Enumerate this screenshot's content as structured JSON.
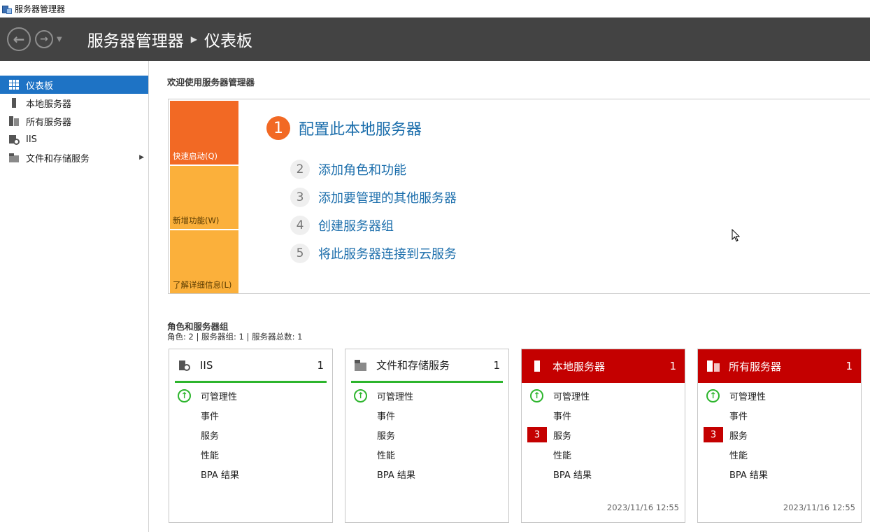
{
  "window": {
    "title": "服务器管理器"
  },
  "header": {
    "breadcrumb": [
      "服务器管理器",
      "仪表板"
    ]
  },
  "sidebar": {
    "items": [
      {
        "label": "仪表板",
        "icon": "dashboard-icon",
        "active": true
      },
      {
        "label": "本地服务器",
        "icon": "server-icon",
        "active": false
      },
      {
        "label": "所有服务器",
        "icon": "servers-icon",
        "active": false
      },
      {
        "label": "IIS",
        "icon": "iis-icon",
        "active": false
      },
      {
        "label": "文件和存储服务",
        "icon": "file-storage-icon",
        "active": false,
        "expandable": true
      }
    ]
  },
  "welcome": {
    "title": "欢迎使用服务器管理器",
    "tabs": [
      "快速启动(Q)",
      "新增功能(W)",
      "了解详细信息(L)"
    ],
    "steps": [
      {
        "num": "1",
        "label": "配置此本地服务器"
      },
      {
        "num": "2",
        "label": "添加角色和功能"
      },
      {
        "num": "3",
        "label": "添加要管理的其他服务器"
      },
      {
        "num": "4",
        "label": "创建服务器组"
      },
      {
        "num": "5",
        "label": "将此服务器连接到云服务"
      }
    ]
  },
  "roles": {
    "title": "角色和服务器组",
    "summary": "角色: 2 | 服务器组: 1 | 服务器总数: 1",
    "cards": [
      {
        "name": "IIS",
        "count": "1",
        "state": "ok",
        "icon": "iis-icon",
        "rows": [
          {
            "label": "可管理性",
            "status": "ok"
          },
          {
            "label": "事件"
          },
          {
            "label": "服务"
          },
          {
            "label": "性能"
          },
          {
            "label": "BPA 结果"
          }
        ],
        "time": ""
      },
      {
        "name": "文件和存储服务",
        "count": "1",
        "state": "ok",
        "icon": "file-storage-icon",
        "rows": [
          {
            "label": "可管理性",
            "status": "ok"
          },
          {
            "label": "事件"
          },
          {
            "label": "服务"
          },
          {
            "label": "性能"
          },
          {
            "label": "BPA 结果"
          }
        ],
        "time": ""
      },
      {
        "name": "本地服务器",
        "count": "1",
        "state": "alert",
        "icon": "server-icon",
        "rows": [
          {
            "label": "可管理性",
            "status": "ok"
          },
          {
            "label": "事件"
          },
          {
            "label": "服务",
            "badge": "3"
          },
          {
            "label": "性能"
          },
          {
            "label": "BPA 结果"
          }
        ],
        "time": "2023/11/16 12:55"
      },
      {
        "name": "所有服务器",
        "count": "1",
        "state": "alert",
        "icon": "servers-icon",
        "rows": [
          {
            "label": "可管理性",
            "status": "ok"
          },
          {
            "label": "事件"
          },
          {
            "label": "服务",
            "badge": "3"
          },
          {
            "label": "性能"
          },
          {
            "label": "BPA 结果"
          }
        ],
        "time": "2023/11/16 12:55"
      }
    ]
  },
  "colors": {
    "header_bg": "#434343",
    "sidebar_active": "#1e73c5",
    "tile_orange": "#f26924",
    "tile_amber": "#fbb03b",
    "link_blue": "#1a6dab",
    "alert_red": "#c40000",
    "ok_green": "#2db52d"
  }
}
